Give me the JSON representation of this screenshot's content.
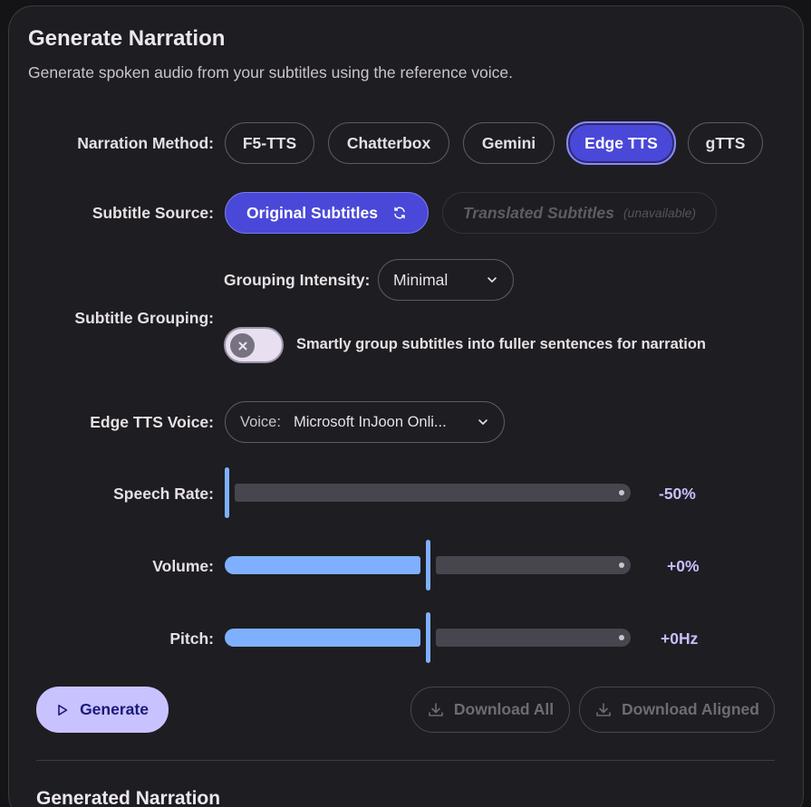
{
  "panel": {
    "title": "Generate Narration",
    "subtitle": "Generate spoken audio from your subtitles using the reference voice."
  },
  "narration_method": {
    "label": "Narration Method:",
    "options": [
      "F5-TTS",
      "Chatterbox",
      "Gemini",
      "Edge TTS",
      "gTTS"
    ],
    "selected": "Edge TTS"
  },
  "subtitle_source": {
    "label": "Subtitle Source:",
    "original": "Original Subtitles",
    "translated": "Translated Subtitles",
    "translated_note": "(unavailable)"
  },
  "subtitle_grouping": {
    "label": "Subtitle Grouping:",
    "intensity_label": "Grouping Intensity:",
    "intensity_value": "Minimal",
    "toggle_text": "Smartly group subtitles into fuller sentences for narration",
    "toggle_on": false
  },
  "voice": {
    "label": "Edge TTS Voice:",
    "prefix": "Voice:",
    "value": "Microsoft InJoon Onli..."
  },
  "speech_rate": {
    "label": "Speech Rate:",
    "display": "-50%",
    "fraction": 0.0
  },
  "volume": {
    "label": "Volume:",
    "display": "+0%",
    "fraction": 0.5
  },
  "pitch": {
    "label": "Pitch:",
    "display": "+0Hz",
    "fraction": 0.5
  },
  "actions": {
    "generate": "Generate",
    "download_all": "Download All",
    "download_aligned": "Download Aligned"
  },
  "generated_section": {
    "title": "Generated Narration"
  },
  "colors": {
    "accent": "#4a48d8",
    "slider_active": "#7fb0ff",
    "value_text": "#c5c0ff",
    "generate_bg": "#c8c3ff"
  }
}
